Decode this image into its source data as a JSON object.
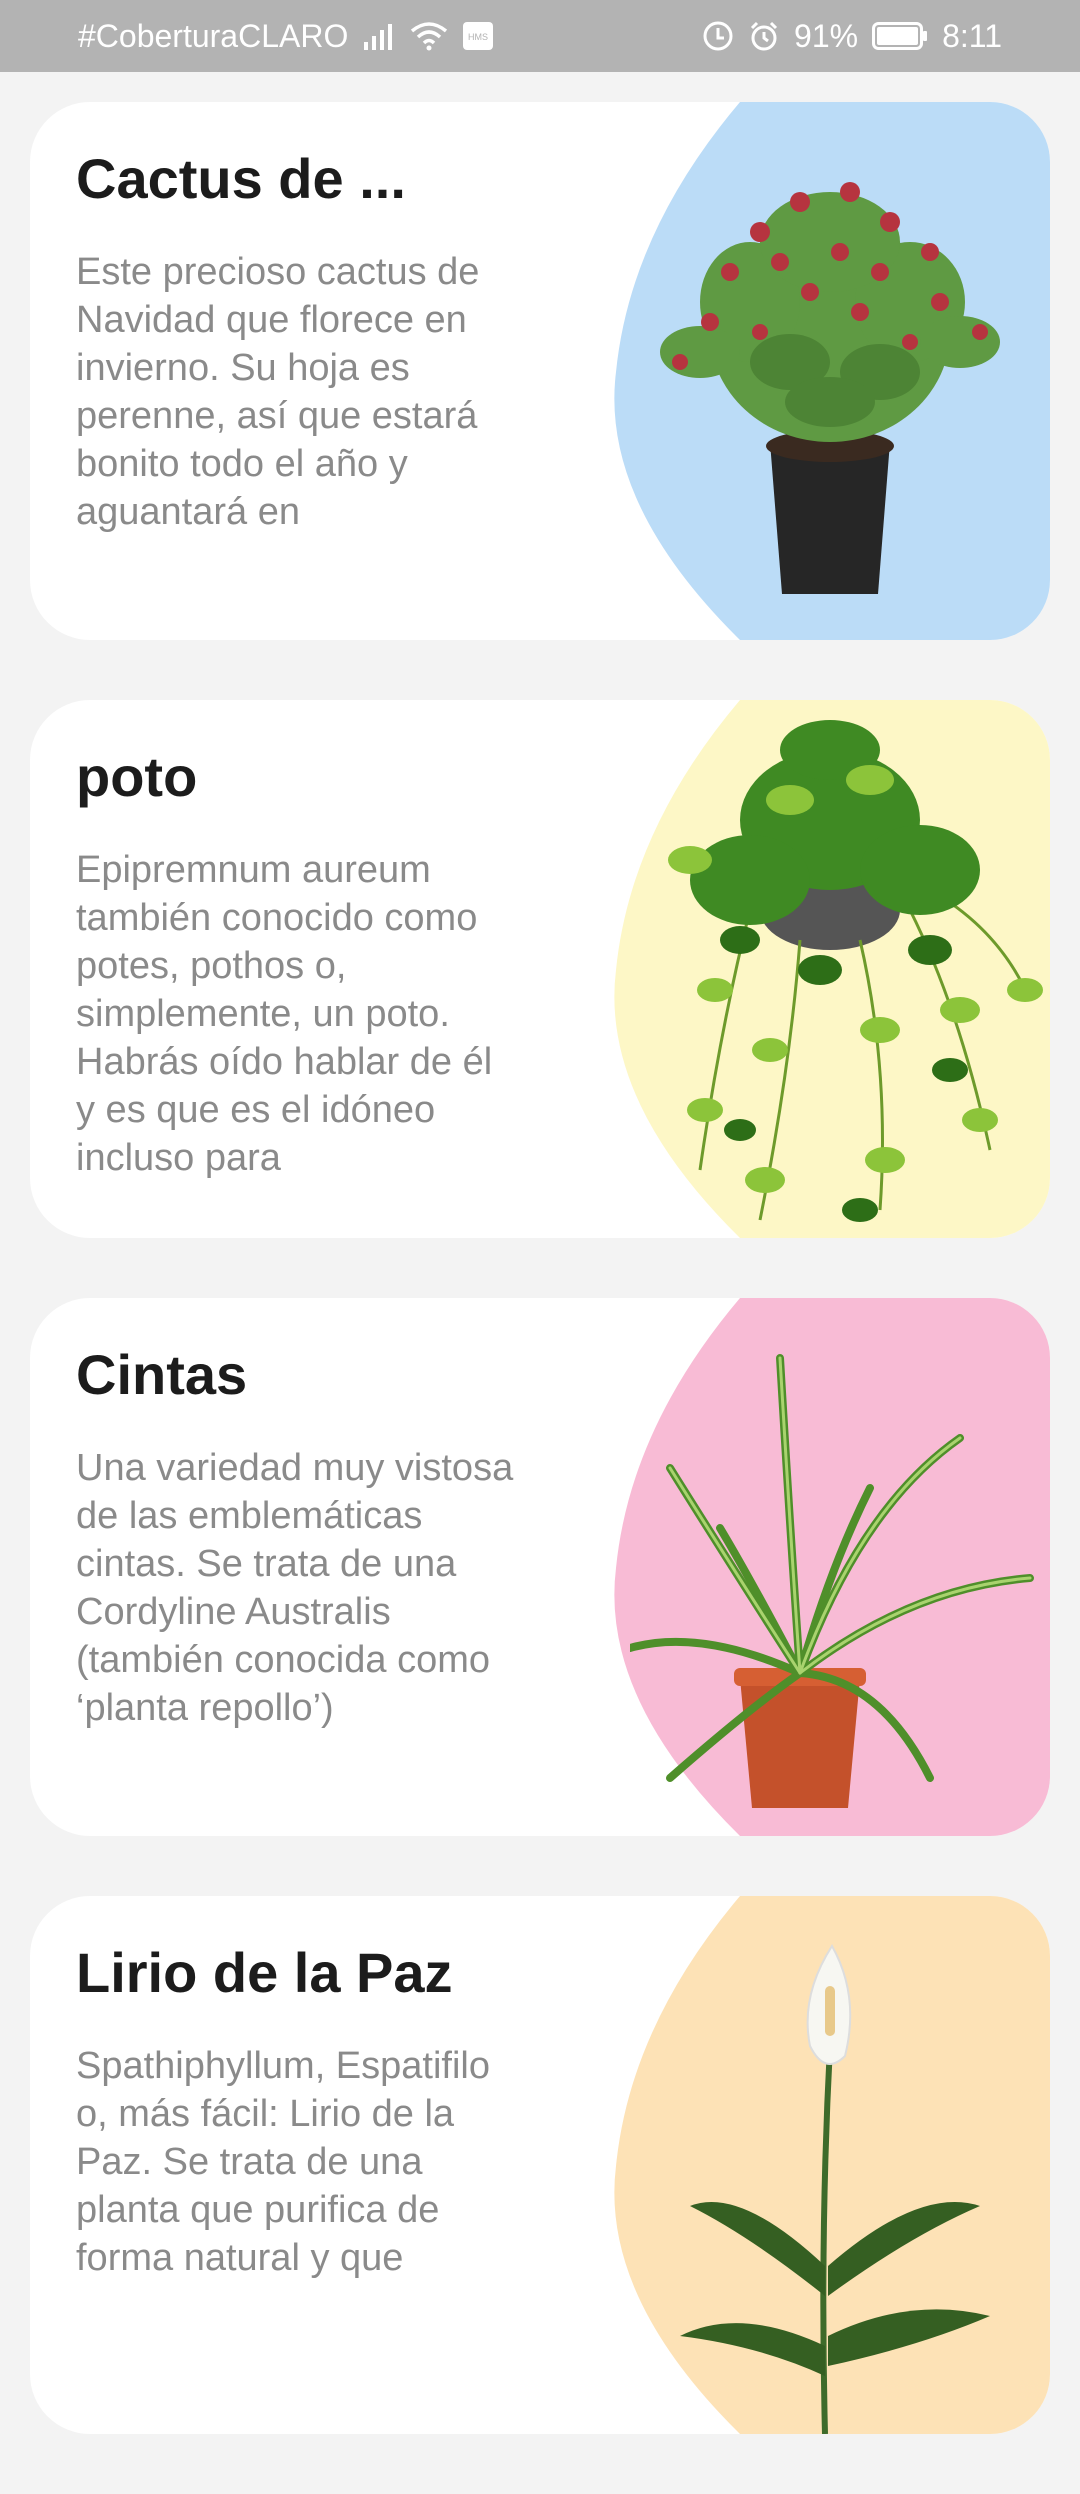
{
  "status_bar": {
    "carrier": "#CoberturaCLARO",
    "battery": "91%",
    "time": "8:11",
    "icons": [
      "signal-icon",
      "wifi-icon",
      "hms-icon",
      "data-saver-icon",
      "alarm-icon",
      "battery-icon"
    ]
  },
  "plants": [
    {
      "title": "Cactus de ...",
      "description": "Este precioso cactus de Navidad que florece en invierno. Su hoja es perenne, así que estará bonito todo el año y aguantará en",
      "accent": "#bbdcf7",
      "image": "christmas-cactus-image"
    },
    {
      "title": "poto",
      "description": "Epipremnum aureum también conocido como potes, pothos o, simplemente, un poto. Habrás oído hablar de él y es que es el idóneo incluso para",
      "accent": "#fdf7c6",
      "image": "pothos-image"
    },
    {
      "title": "Cintas",
      "description": "Una variedad muy vistosa de las emblemáticas cintas. Se trata de una Cordyline Australis (también conocida como ‘planta repollo’)",
      "accent": "#f8bbd5",
      "image": "spider-plant-image"
    },
    {
      "title": "Lirio de la Paz",
      "description": "Spathiphyllum, Espatifilo o, más fácil: Lirio de la Paz. Se trata de una planta que purifica de forma natural y que",
      "accent": "#fde2b6",
      "image": "peace-lily-image"
    }
  ]
}
